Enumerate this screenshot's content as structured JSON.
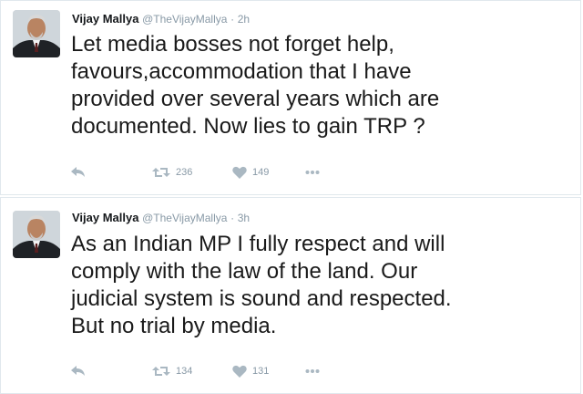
{
  "tweets": [
    {
      "name": "Vijay Mallya",
      "handle": "@TheVijayMallya",
      "separator": "·",
      "time": "2h",
      "text": "Let media bosses not forget help,\nfavours,accommodation that I have\nprovided over several years which are\ndocumented. Now lies to gain TRP ?",
      "retweets": "236",
      "likes": "149",
      "icons": [
        "reply-icon",
        "retweet-icon",
        "heart-icon",
        "more-icon"
      ]
    },
    {
      "name": "Vijay Mallya",
      "handle": "@TheVijayMallya",
      "separator": "·",
      "time": "3h",
      "text": "As an Indian MP I fully respect and will\ncomply with the law of the land. Our\njudicial system is sound and respected.\nBut no trial by media.",
      "retweets": "134",
      "likes": "131",
      "icons": [
        "reply-icon",
        "retweet-icon",
        "heart-icon",
        "more-icon"
      ]
    }
  ],
  "colors": {
    "meta": "#8899a6",
    "text": "#14171a",
    "border": "#e1e8ed"
  }
}
